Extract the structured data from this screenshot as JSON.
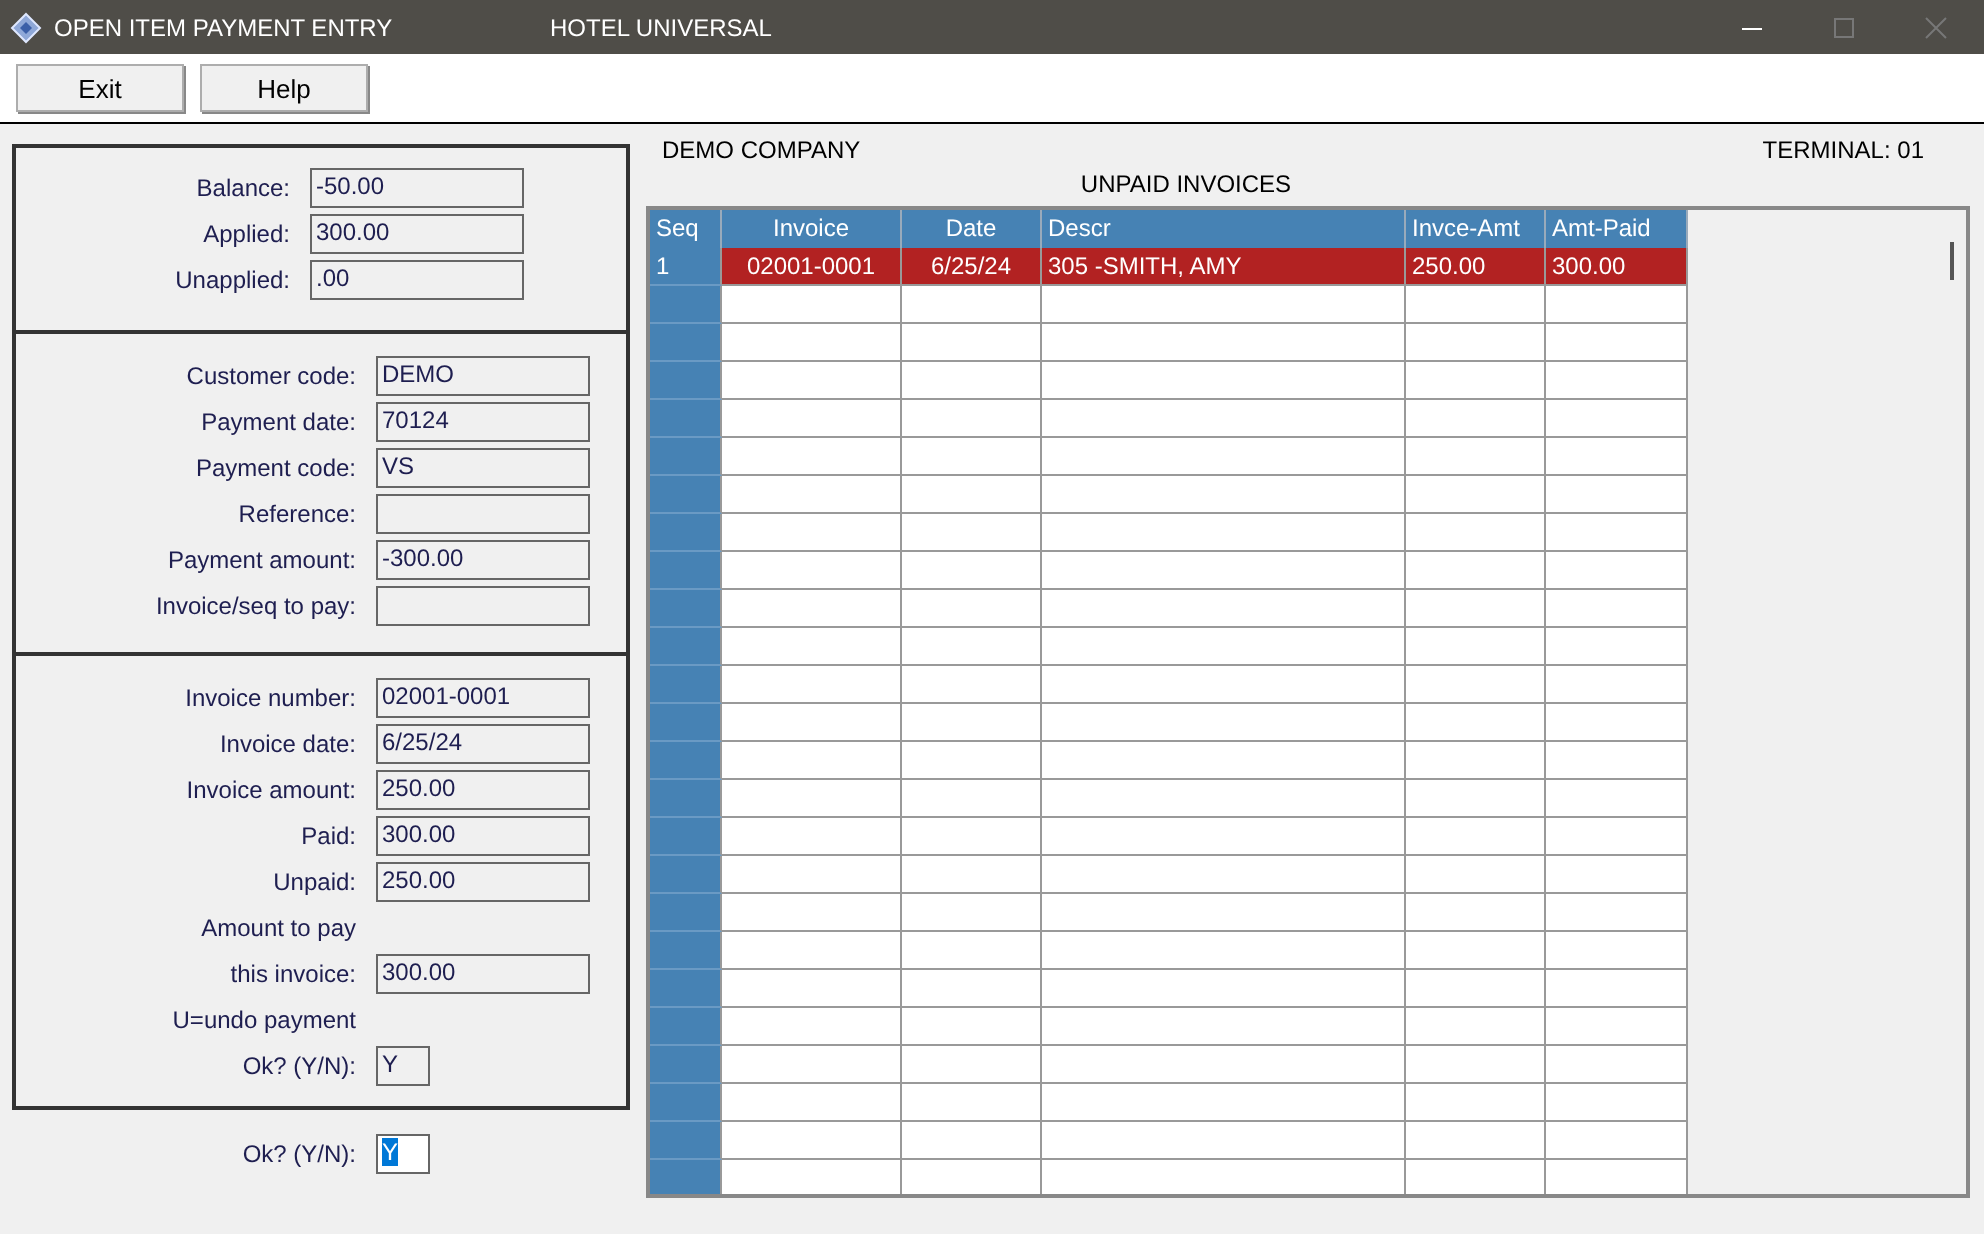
{
  "window": {
    "title": "OPEN ITEM PAYMENT ENTRY",
    "subtitle": "HOTEL UNIVERSAL"
  },
  "toolbar": {
    "buttons": [
      "Exit",
      "Help"
    ]
  },
  "summary": {
    "fields": [
      {
        "label": "Balance:",
        "value": "-50.00"
      },
      {
        "label": "Applied:",
        "value": "300.00"
      },
      {
        "label": "Unapplied:",
        "value": ".00"
      }
    ]
  },
  "payment": {
    "fields": [
      {
        "label": "Customer code:",
        "value": "DEMO"
      },
      {
        "label": "Payment date:",
        "value": "70124"
      },
      {
        "label": "Payment code:",
        "value": "VS"
      },
      {
        "label": "Reference:"
      },
      {
        "label": "Payment amount:",
        "value": "-300.00"
      },
      {
        "label": "Invoice/seq to pay:"
      }
    ]
  },
  "invoice": {
    "fields": [
      {
        "kind": "field",
        "label": "Invoice number:",
        "value": "02001-0001"
      },
      {
        "kind": "field",
        "label": "Invoice date:",
        "value": "6/25/24"
      },
      {
        "kind": "field",
        "label": "Invoice amount:",
        "value": "250.00"
      },
      {
        "kind": "field",
        "label": "Paid:",
        "value": "300.00"
      },
      {
        "kind": "field",
        "label": "Unpaid:",
        "value": "250.00"
      },
      {
        "kind": "text",
        "label": "Amount to pay"
      },
      {
        "kind": "field",
        "label": "this invoice:",
        "value": "300.00"
      },
      {
        "kind": "text",
        "label": "U=undo payment"
      },
      {
        "kind": "short",
        "label": "Ok? (Y/N):",
        "value": "Y"
      }
    ]
  },
  "confirm": {
    "label": "Ok? (Y/N):",
    "value": "Y",
    "text_selected": true
  },
  "header": {
    "company": "DEMO COMPANY",
    "terminal": "TERMINAL: 01"
  },
  "table": {
    "title": "UNPAID INVOICES",
    "columns": [
      "Seq",
      "Invoice",
      "Date",
      "Descr",
      "Invce-Amt",
      "Amt-Paid"
    ],
    "rows": [
      {
        "selected": true,
        "cells": [
          "1",
          "02001-0001",
          "6/25/24",
          "305 -SMITH, AMY",
          "250.00",
          "300.00"
        ]
      }
    ]
  }
}
